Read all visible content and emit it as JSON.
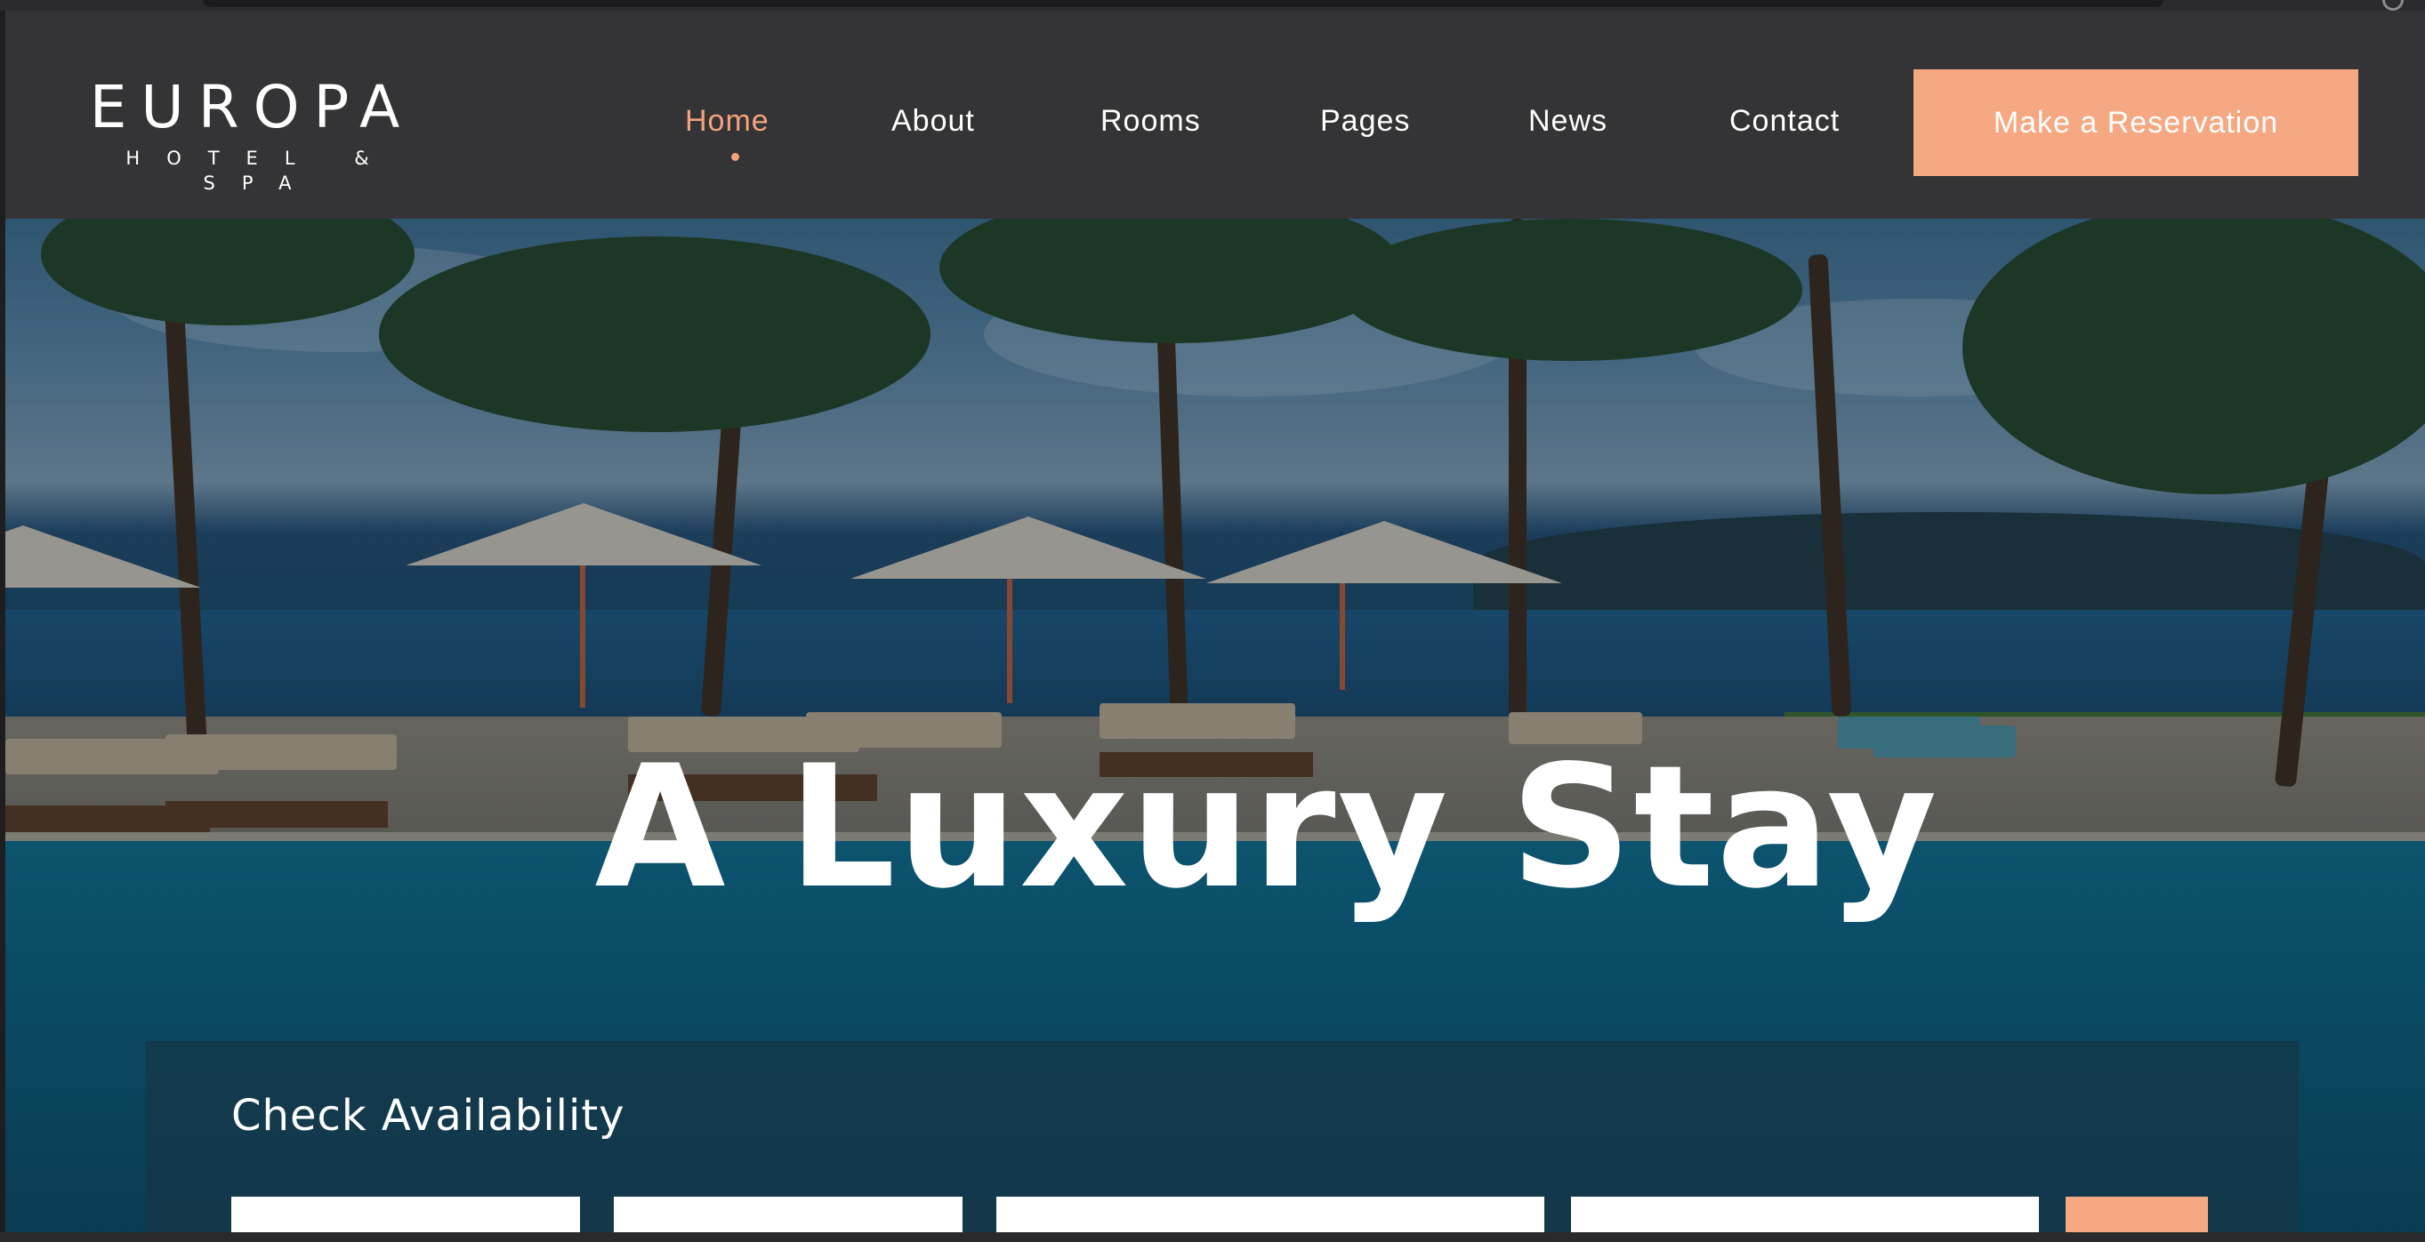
{
  "brand": {
    "name": "EUROPA",
    "tagline": "HOTEL & SPA"
  },
  "nav": {
    "items": [
      {
        "label": "Home",
        "active": true
      },
      {
        "label": "About",
        "active": false
      },
      {
        "label": "Rooms",
        "active": false
      },
      {
        "label": "Pages",
        "active": false
      },
      {
        "label": "News",
        "active": false
      },
      {
        "label": "Contact",
        "active": false
      }
    ],
    "cta_label": "Make a Reservation"
  },
  "hero": {
    "title": "A Luxury Stay"
  },
  "availability": {
    "title": "Check Availability"
  },
  "colors": {
    "accent": "#f6a882",
    "header_bg": "#343436",
    "text": "#ffffff"
  }
}
